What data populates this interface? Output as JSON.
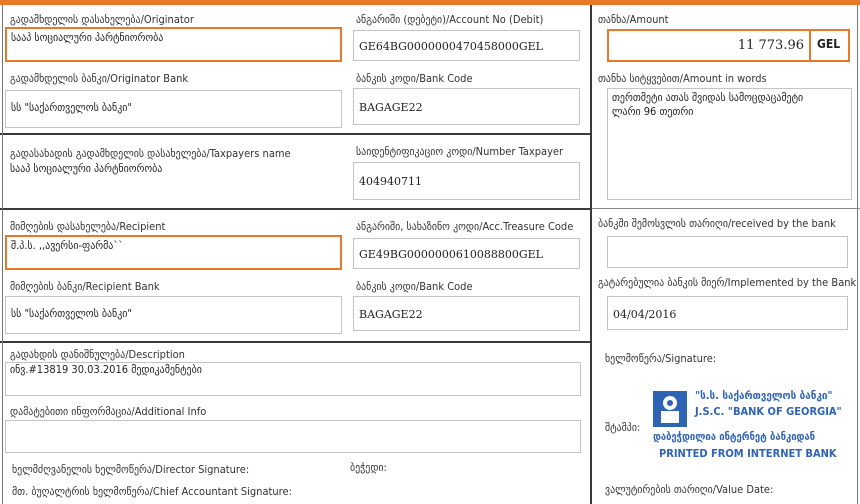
{
  "fields": {
    "originator_label": "გადამხდელის დასახელება/Originator",
    "originator_value": "სააპ სოციალური პარტნიორობა",
    "account_debit_label": "ანგარიში (დებეტი)/Account No (Debit)",
    "account_debit_value": "GE64BG0000000470458000GEL",
    "amount_label": "თანხა/Amount",
    "amount_value": "11 773.96",
    "currency": "GEL",
    "originator_bank_label": "გადამხდელის ბანკი/Originator Bank",
    "originator_bank_value": "სს \"საქართველოს ბანკი\"",
    "bank_code_label": "ბანკის კოდი/Bank Code",
    "bank_code_value": "BAGAGE22",
    "amount_words_label": "თანხა სიტყვებით/Amount in words",
    "amount_words_line1": "თერთმეტი ათას შვიდას სამოცდაცამეტი",
    "amount_words_line2": "ლარი 96 თეთრი",
    "taxpayer_name_label": "გადასახადის გადამხდელის დასახელება/Taxpayers name",
    "taxpayer_name_value": "სააპ სოციალური პარტნიორობა",
    "taxpayer_number_label": "საიდენტიფიკაციო კოდი/Number Taxpayer",
    "taxpayer_number_value": "404940711",
    "recipient_label": "მიმღების დასახელება/Recipient",
    "recipient_value": "შ.პ.ს. ,,ავერსი-ფარმა``",
    "account_treasury_label": "ანგარიში, სახაზინო კოდი/Acc.Treasure Code",
    "account_treasury_value": "GE49BG0000000610088800GEL",
    "received_label": "ბანკში შემოსვლის თარიღი/received by the bank",
    "received_value": "",
    "recipient_bank_label": "მიმღების ბანკი/Recipient Bank",
    "recipient_bank_value": "სს \"საქართველოს ბანკი\"",
    "bank_code2_label": "ბანკის კოდი/Bank Code",
    "bank_code2_value": "BAGAGE22",
    "implemented_label": "გატარებულია ბანკის მიერ/Implemented by the Bank",
    "implemented_value": "04/04/2016",
    "description_label": "გადახდის დანიშნულება/Description",
    "description_value": "ინვ.#13819 30.03.2016 მედიკამენტები",
    "signature_label": "ხელმოწერა/Signature:",
    "additional_label": "დამატებითი ინფორმაცია/Additional Info",
    "additional_value": "",
    "stamp_label": "შტამპი:",
    "director_sig_label": "ხელმძღვანელის ხელმოწერა/Director Signature:",
    "seal_label": "ბეჭედი:",
    "chief_acc_label": "მთ. ბუღალტრის ხელმოწერა/Chief Accountant Signature:",
    "value_date_label": "ვალუტირების თარიღი/Value Date:"
  },
  "stamp": {
    "line1": "\"ს.ს. საქართველოს ბანკი\"",
    "line2": "J.S.C. \"BANK OF GEORGIA\"",
    "line3": "დაბეჭდილია ინტერნეტ ბანკიდან",
    "line4": "PRINTED FROM INTERNET BANK"
  },
  "colors": {
    "accent": "#e8792b",
    "stamp_blue": "#2f63b5"
  }
}
